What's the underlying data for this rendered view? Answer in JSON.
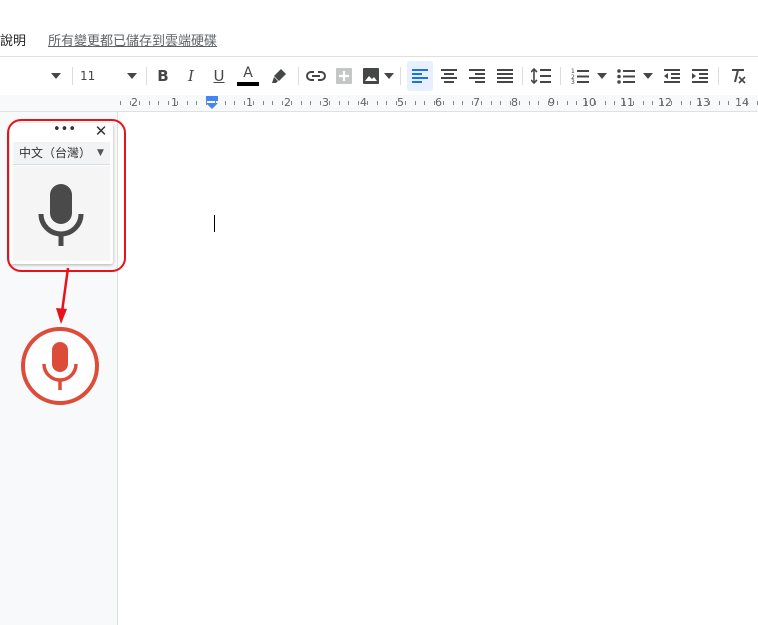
{
  "menu": {
    "help_partial": "說明",
    "save_status": "所有變更都已儲存到雲端硬碟"
  },
  "toolbar": {
    "font_size": "11",
    "bold": "B",
    "italic": "I",
    "underline": "U",
    "text_color": "A"
  },
  "ruler": {
    "labels": [
      "2",
      "1",
      "1",
      "2",
      "3",
      "4",
      "5",
      "6",
      "7",
      "8",
      "9",
      "10",
      "11",
      "12",
      "13",
      "14"
    ]
  },
  "voice_widget": {
    "more": "•••",
    "close": "✕",
    "language": "中文（台灣）"
  },
  "colors": {
    "highlight": "#e8131a",
    "mic_active": "#dd4b39",
    "mic_idle": "#4a4a4a",
    "accent": "#1a73e8"
  }
}
